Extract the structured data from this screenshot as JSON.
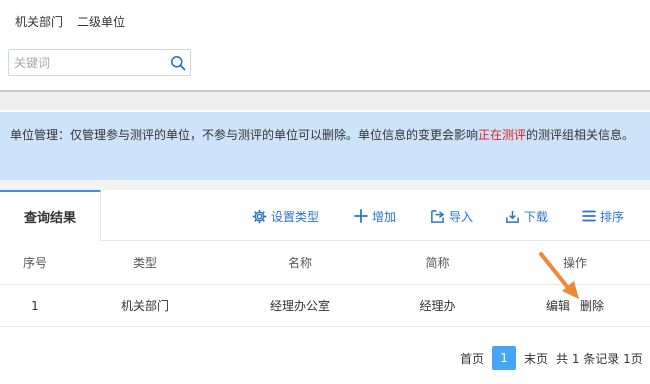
{
  "top_tabs": [
    "机关部门",
    "二级单位"
  ],
  "search": {
    "placeholder": "关键词",
    "value": ""
  },
  "notice": {
    "before": "单位管理：仅管理参与测评的单位，不参与测评的单位可以删除。单位信息的变更会影响",
    "highlight": "正在测评",
    "after": "的测评组相关信息。"
  },
  "colors": {
    "accent": "#2a74d0",
    "notice_bg": "#cde3fa",
    "highlight": "#e02020",
    "arrow": "#f0883a",
    "page_active": "#46a6f5"
  },
  "result_tab": "查询结果",
  "toolbar": {
    "set_type": "设置类型",
    "add": "增加",
    "import": "导入",
    "download": "下载",
    "sort": "排序"
  },
  "table": {
    "headers": [
      "序号",
      "类型",
      "名称",
      "简称",
      "操作"
    ],
    "rows": [
      {
        "index": "1",
        "type": "机关部门",
        "name": "经理办公室",
        "short": "经理办",
        "edit": "编辑",
        "delete": "删除"
      }
    ]
  },
  "pagination": {
    "first": "首页",
    "current": "1",
    "last": "末页",
    "summary": "共 1 条记录 1页"
  }
}
